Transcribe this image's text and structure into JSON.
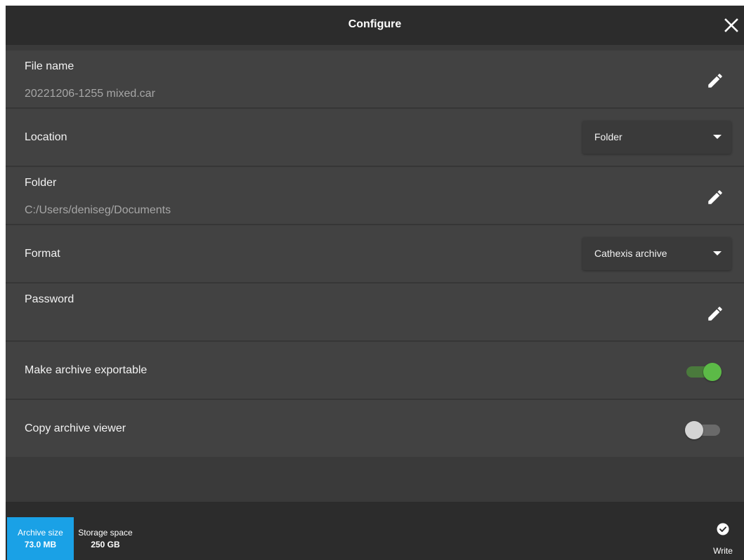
{
  "header": {
    "title": "Configure",
    "close_icon": "close-icon"
  },
  "rows": {
    "file_name": {
      "label": "File name",
      "value": "20221206-1255 mixed.car",
      "icon": "pencil-icon"
    },
    "location": {
      "label": "Location",
      "selected": "Folder",
      "icon": "caret-down-icon"
    },
    "folder": {
      "label": "Folder",
      "value": "C:/Users/deniseg/Documents",
      "icon": "pencil-icon"
    },
    "format": {
      "label": "Format",
      "selected": "Cathexis archive",
      "icon": "caret-down-icon"
    },
    "password": {
      "label": "Password",
      "value": "",
      "icon": "pencil-icon"
    },
    "exportable": {
      "label": "Make archive exportable",
      "checked": true
    },
    "viewer": {
      "label": "Copy archive viewer",
      "checked": false
    }
  },
  "footer": {
    "archive_size_label": "Archive size",
    "archive_size_value": "73.0 MB",
    "storage_label": "Storage space",
    "storage_value": "250 GB",
    "write_label": "Write",
    "write_icon": "check-circle-icon"
  },
  "colors": {
    "accent_blue": "#1aa1e6",
    "toggle_on": "#5cba47",
    "toggle_off": "#d4d4d4",
    "panel_row": "#424242",
    "panel_bar": "#2c2c2c"
  }
}
